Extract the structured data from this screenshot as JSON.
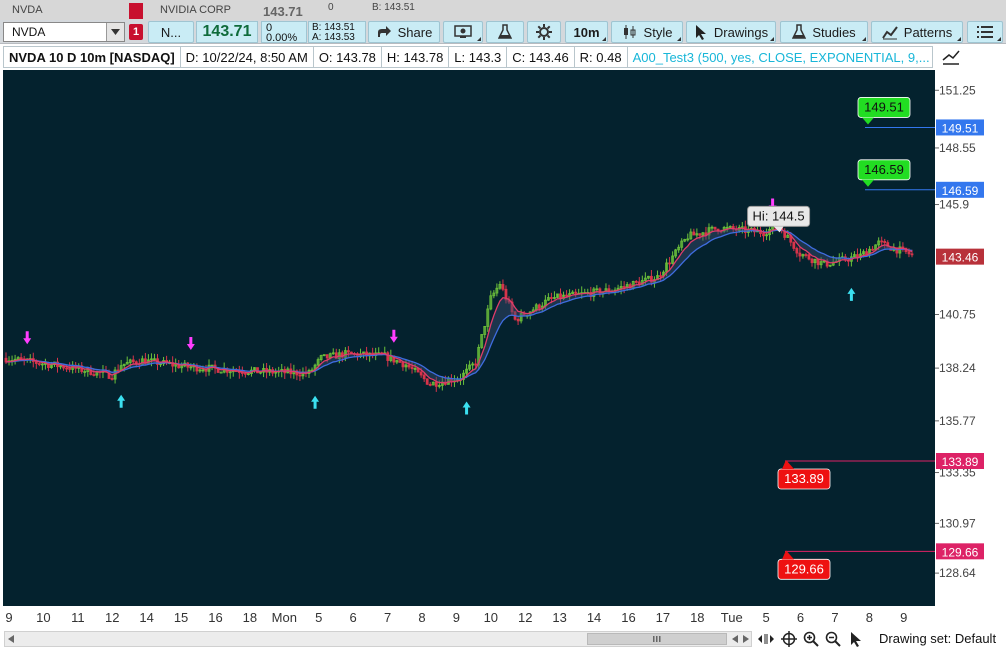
{
  "top_strip": {
    "symbol": "NVDA",
    "company": "NVIDIA CORP",
    "price": "143.71",
    "size": "0",
    "bid": "B: 143.51"
  },
  "toolbar": {
    "symbol_value": "NVDA",
    "link_badge": "1",
    "company_short": "N...",
    "last_price": "143.71",
    "change": "0",
    "change_pct": "0.00%",
    "bid": "B: 143.51",
    "ask": "A: 143.53",
    "share_label": "Share",
    "timeframe_label": "10m",
    "style_label": "Style",
    "drawings_label": "Drawings",
    "studies_label": "Studies",
    "patterns_label": "Patterns"
  },
  "infobar": {
    "title": "NVDA 10 D 10m [NASDAQ]",
    "date": "D: 10/22/24, 8:50 AM",
    "open": "O: 143.78",
    "high": "H: 143.78",
    "low": "L: 143.3",
    "close": "C: 143.46",
    "range": "R: 0.48",
    "study": "A00_Test3 (500, yes, CLOSE, EXPONENTIAL, 9,..."
  },
  "colors": {
    "background": "#04222e",
    "up_bar": "#6cc23a",
    "down_bar": "#d8344a",
    "ma_fast": "#e03c6a",
    "ma_slow": "#3f6de0",
    "arrow_up": "#3be0f0",
    "arrow_down": "#ff3dff",
    "target_green": "#22dd22",
    "target_blue": "#3377ee",
    "stop_red": "#ee1111",
    "stop_pink": "#dd2266",
    "last_price_bg": "#b8313a"
  },
  "chart_data": {
    "type": "candlestick",
    "ylim": [
      127.1,
      152.2
    ],
    "price_ticks": [
      151.25,
      148.55,
      145.9,
      140.75,
      138.24,
      135.77,
      133.35,
      130.97,
      128.64
    ],
    "time_labels": [
      "9",
      "10",
      "11",
      "12",
      "14",
      "15",
      "16",
      "18",
      "Mon",
      "5",
      "6",
      "7",
      "8",
      "9",
      "10",
      "12",
      "13",
      "14",
      "16",
      "17",
      "18",
      "Tue",
      "5",
      "6",
      "7",
      "8",
      "9"
    ],
    "n_bars": 300,
    "key_points": [
      [
        0,
        138.7
      ],
      [
        20,
        138.3
      ],
      [
        35,
        137.9
      ],
      [
        38,
        138.4
      ],
      [
        45,
        138.6
      ],
      [
        60,
        138.3
      ],
      [
        80,
        138.1
      ],
      [
        100,
        138.0
      ],
      [
        104,
        138.7
      ],
      [
        112,
        138.9
      ],
      [
        125,
        138.8
      ],
      [
        132,
        138.4
      ],
      [
        140,
        137.5
      ],
      [
        150,
        137.8
      ],
      [
        155,
        138.5
      ],
      [
        160,
        141.5
      ],
      [
        163,
        142.2
      ],
      [
        168,
        140.5
      ],
      [
        180,
        141.5
      ],
      [
        200,
        141.9
      ],
      [
        215,
        142.5
      ],
      [
        225,
        144.4
      ],
      [
        235,
        144.8
      ],
      [
        250,
        144.6
      ],
      [
        255,
        144.9
      ],
      [
        262,
        143.6
      ],
      [
        270,
        143.1
      ],
      [
        282,
        143.5
      ],
      [
        288,
        144.1
      ],
      [
        300,
        143.5
      ]
    ],
    "last_price": {
      "value": 143.46,
      "label": "143.46"
    },
    "high_label": {
      "text": "Hi: 144.5",
      "value": 144.5,
      "bar": 252
    },
    "targets": [
      {
        "label": "149.51",
        "axis_label": "149.51",
        "value": 149.51
      },
      {
        "label": "146.59",
        "axis_label": "146.59",
        "value": 146.59
      }
    ],
    "stops": [
      {
        "label": "133.89",
        "axis_label": "133.89",
        "value": 133.89
      },
      {
        "label": "129.66",
        "axis_label": "129.66",
        "value": 129.66
      }
    ],
    "signals_up": [
      38,
      102,
      152,
      279
    ],
    "signals_down": [
      7,
      61,
      128,
      253
    ]
  },
  "bottom": {
    "drawing_set": "Drawing set: Default"
  }
}
